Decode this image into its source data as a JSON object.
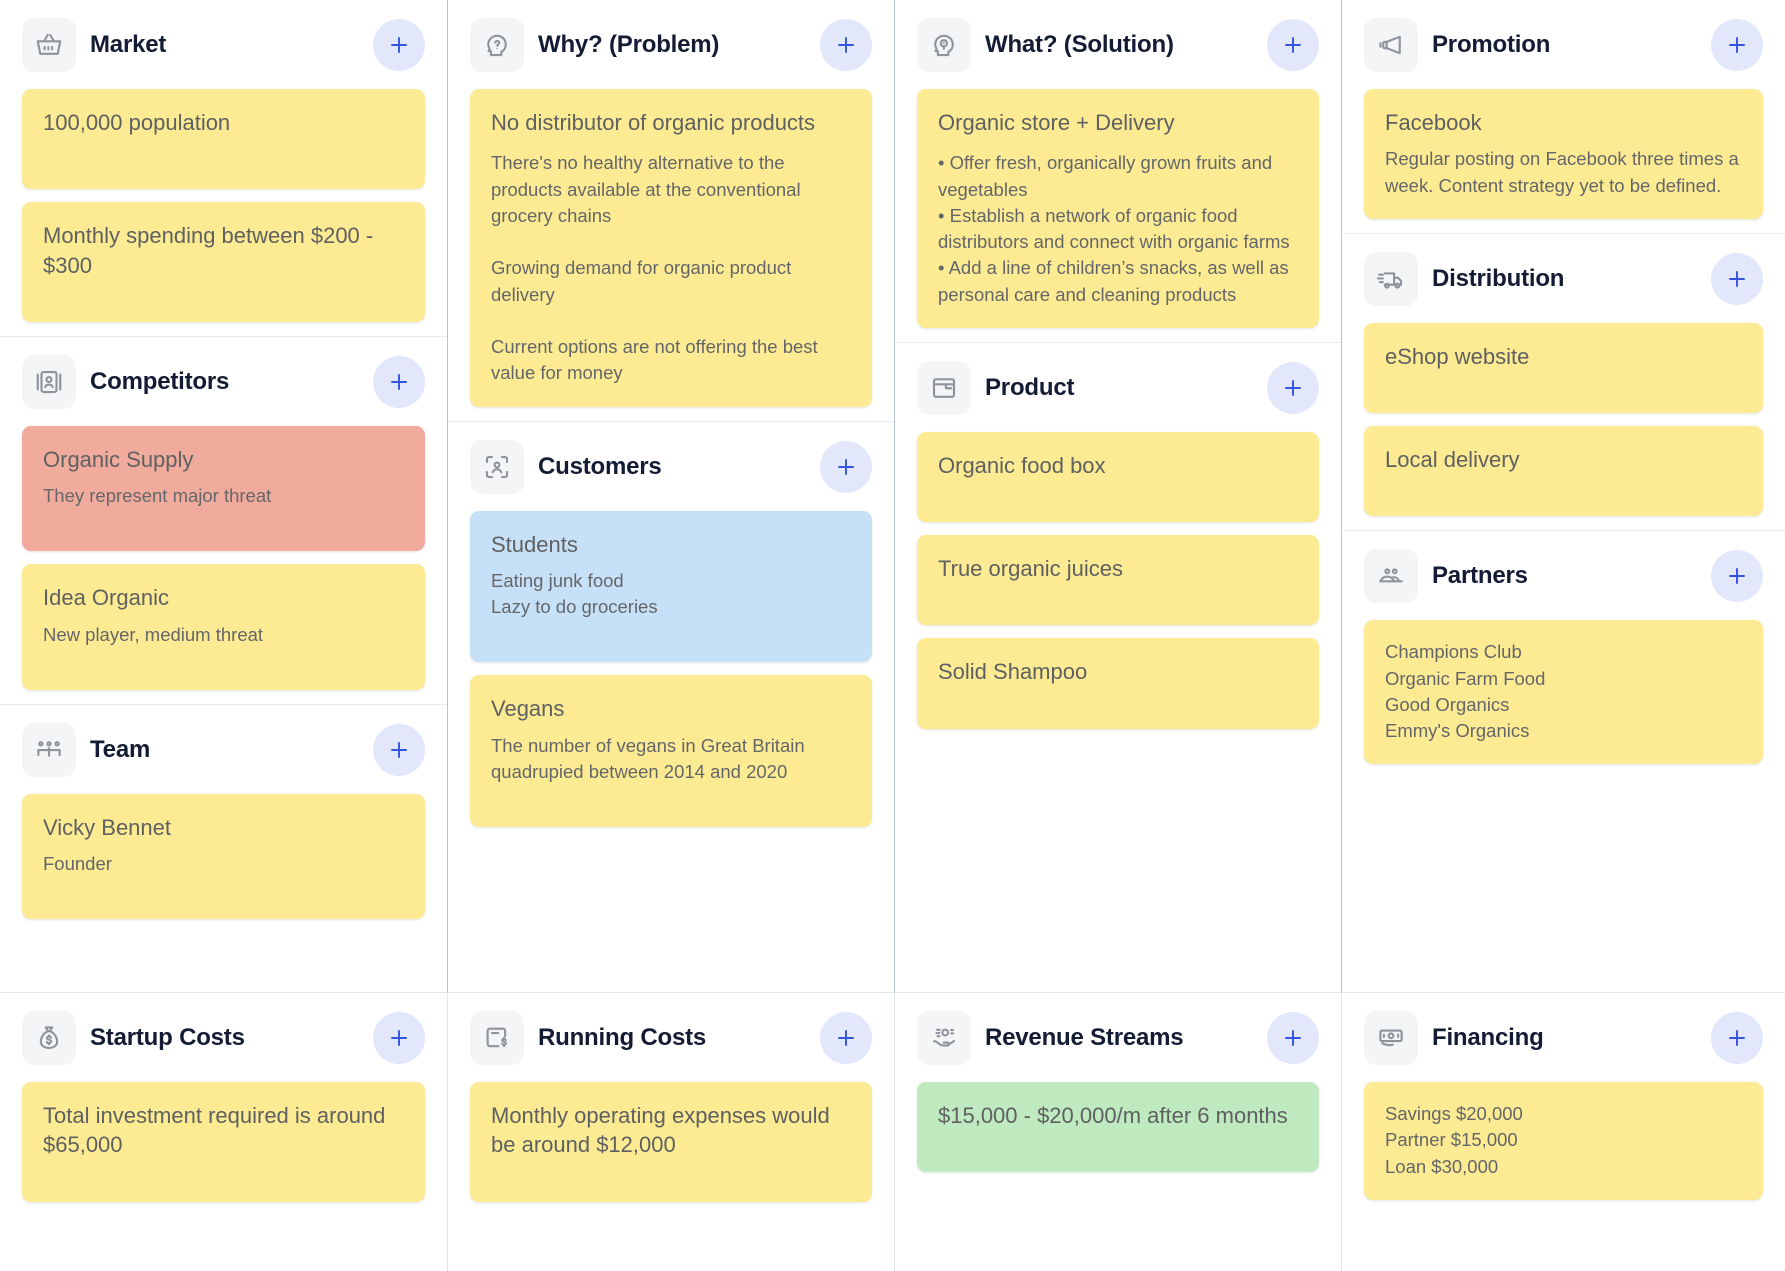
{
  "colors": {
    "card_yellow": "#fceb92",
    "card_red": "#f1ab9d",
    "card_blue": "#c6e1f7",
    "card_green": "#bfe9be",
    "add_button_bg": "#e2e7fb",
    "add_button_plus": "#3355dd",
    "icon_tile_bg": "#f4f5f7",
    "title_text": "#141b34",
    "card_text": "#5f6061"
  },
  "add_label": "+",
  "blocks": {
    "market": {
      "title": "Market",
      "icon": "shopping-basket-icon",
      "cards": [
        {
          "title": "100,000 population"
        },
        {
          "title": "Monthly spending between $200 - $300"
        }
      ]
    },
    "competitors": {
      "title": "Competitors",
      "icon": "contact-card-icon",
      "cards": [
        {
          "title": "Organic Supply",
          "body": "They represent major threat",
          "color": "red"
        },
        {
          "title": "Idea Organic",
          "body": "New player, medium threat",
          "color": "yellow"
        }
      ]
    },
    "team": {
      "title": "Team",
      "icon": "team-people-icon",
      "cards": [
        {
          "title": "Vicky Bennet",
          "body": "Founder"
        }
      ]
    },
    "why_problem": {
      "title": "Why? (Problem)",
      "icon": "head-question-icon",
      "cards": [
        {
          "title": "No distributor of organic products",
          "body": "There's no healthy alternative to the products available at the conventional grocery chains\n\nGrowing demand for organic product delivery\n\nCurrent options are not offering the best value for money"
        }
      ]
    },
    "customers": {
      "title": "Customers",
      "icon": "customer-frame-icon",
      "cards": [
        {
          "title": "Students",
          "body": "Eating junk food\nLazy to do groceries",
          "color": "blue"
        },
        {
          "title": "Vegans",
          "body": "The number of vegans in Great Britain quadrupied between 2014 and 2020",
          "color": "yellow"
        }
      ]
    },
    "what_solution": {
      "title": "What? (Solution)",
      "icon": "head-idea-icon",
      "cards": [
        {
          "title": "Organic store + Delivery",
          "body": "• Offer fresh, organically grown fruits and vegetables\n• Establish a network of organic food distributors and connect with organic farms\n• Add a line of children’s snacks, as well as personal care and cleaning products"
        }
      ]
    },
    "product": {
      "title": "Product",
      "icon": "product-box-icon",
      "cards": [
        {
          "title": "Organic food box"
        },
        {
          "title": "True organic juices"
        },
        {
          "title": "Solid Shampoo"
        }
      ]
    },
    "promotion": {
      "title": "Promotion",
      "icon": "megaphone-icon",
      "cards": [
        {
          "title": "Facebook",
          "body": "Regular posting on Facebook three times a week. Content strategy yet to be defined."
        }
      ]
    },
    "distribution": {
      "title": "Distribution",
      "icon": "delivery-truck-icon",
      "cards": [
        {
          "title": "eShop website"
        },
        {
          "title": "Local delivery"
        }
      ]
    },
    "partners": {
      "title": "Partners",
      "icon": "two-people-icon",
      "cards": [
        {
          "body": "Champions Club\nOrganic Farm Food\nGood Organics\nEmmy's Organics"
        }
      ]
    },
    "startup_costs": {
      "title": "Startup Costs",
      "icon": "money-bag-icon",
      "cards": [
        {
          "title": "Total investment required is around $65,000"
        }
      ]
    },
    "running_costs": {
      "title": "Running Costs",
      "icon": "invoice-dollar-icon",
      "cards": [
        {
          "title": "Monthly operating expenses would be around $12,000"
        }
      ]
    },
    "revenue_streams": {
      "title": "Revenue Streams",
      "icon": "money-hand-icon",
      "cards": [
        {
          "title": "$15,000 - $20,000/m after 6 months",
          "color": "green"
        }
      ]
    },
    "financing": {
      "title": "Financing",
      "icon": "banknote-icon",
      "cards": [
        {
          "body": "Savings $20,000\nPartner $15,000\nLoan $30,000"
        }
      ]
    }
  }
}
